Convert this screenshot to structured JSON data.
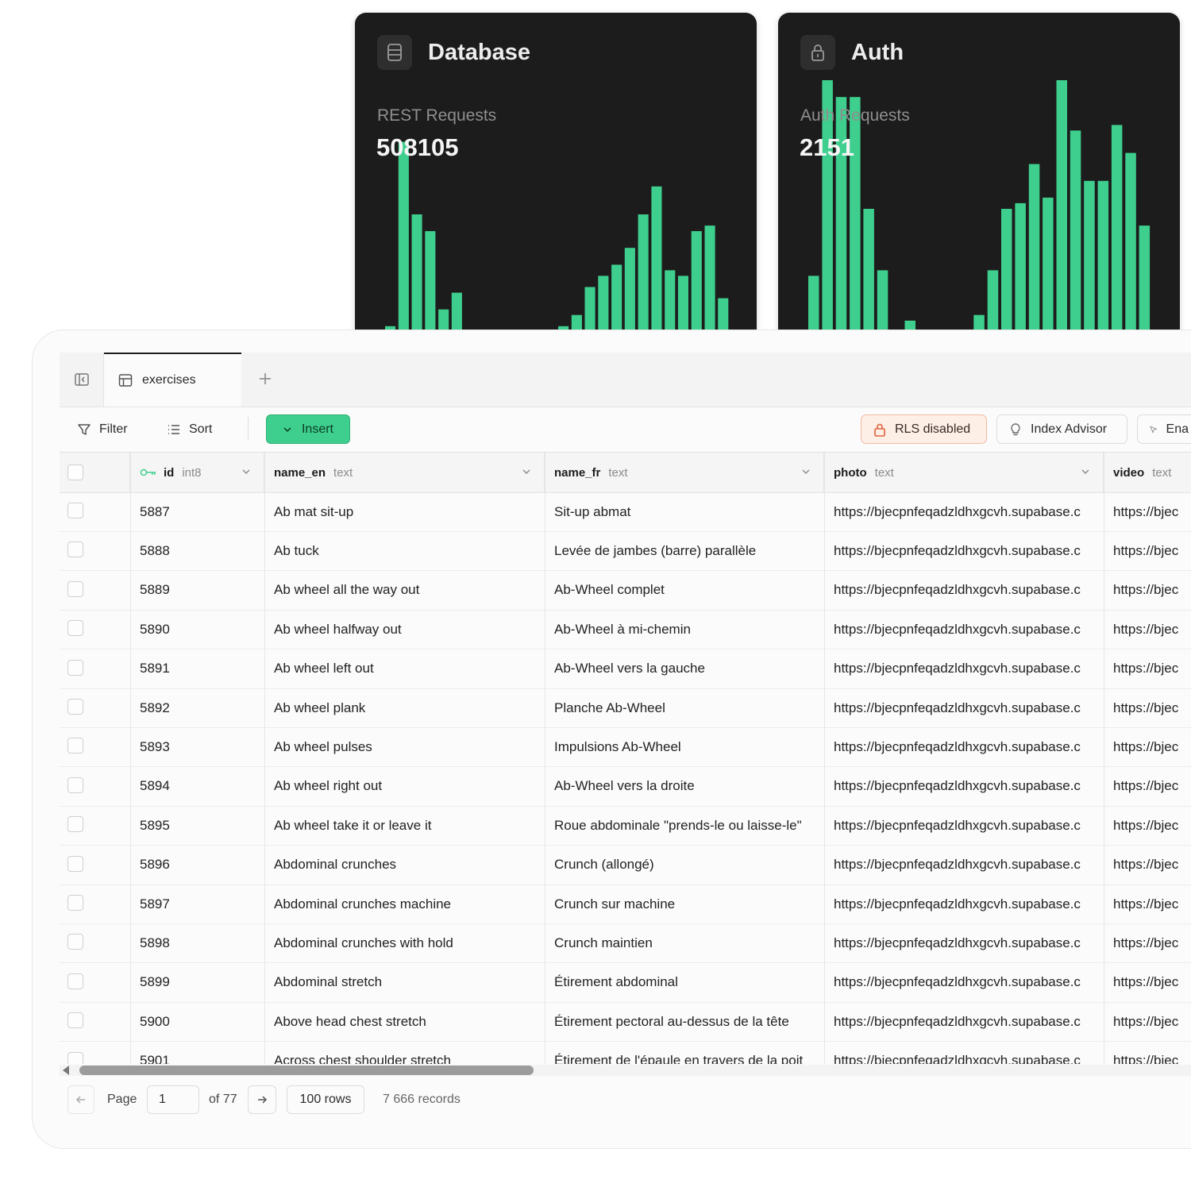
{
  "cards": {
    "database": {
      "title": "Database",
      "metric_label": "REST Requests",
      "metric_value": "508105",
      "icon": "database-icon",
      "bars": [
        5,
        38,
        25,
        22,
        8,
        11,
        4,
        1,
        0,
        0,
        0,
        0,
        1,
        5,
        7,
        12,
        14,
        16,
        19,
        25,
        30,
        15,
        14,
        22,
        23,
        10
      ],
      "accent": "#3ecf8e"
    },
    "auth": {
      "title": "Auth",
      "metric_label": "Auth Requests",
      "metric_value": "2151",
      "icon": "lock-icon",
      "bars": [
        14,
        49,
        46,
        46,
        26,
        15,
        4,
        6,
        3,
        1,
        1,
        2,
        7,
        15,
        26,
        27,
        34,
        28,
        49,
        40,
        31,
        31,
        41,
        36,
        23
      ],
      "accent": "#3ecf8e"
    }
  },
  "tabs": [
    {
      "label": "exercises",
      "icon": "table-icon"
    }
  ],
  "toolbar": {
    "filter_label": "Filter",
    "sort_label": "Sort",
    "insert_label": "Insert",
    "rls_label": "RLS disabled",
    "index_advisor_label": "Index Advisor",
    "enable_label": "Ena"
  },
  "columns": [
    {
      "name": "id",
      "type": "int8",
      "key": "key-icon"
    },
    {
      "name": "name_en",
      "type": "text"
    },
    {
      "name": "name_fr",
      "type": "text"
    },
    {
      "name": "photo",
      "type": "text"
    },
    {
      "name": "video",
      "type": "text"
    }
  ],
  "rows": [
    {
      "id": "5887",
      "name_en": "Ab mat sit-up",
      "name_fr": "Sit-up abmat",
      "photo": "https://bjecpnfeqadzldhxgcvh.supabase.c",
      "video": "https://bjec"
    },
    {
      "id": "5888",
      "name_en": "Ab tuck",
      "name_fr": "Levée de jambes (barre) parallèle",
      "photo": "https://bjecpnfeqadzldhxgcvh.supabase.c",
      "video": "https://bjec"
    },
    {
      "id": "5889",
      "name_en": "Ab wheel all the way out",
      "name_fr": "Ab-Wheel complet",
      "photo": "https://bjecpnfeqadzldhxgcvh.supabase.c",
      "video": "https://bjec"
    },
    {
      "id": "5890",
      "name_en": "Ab wheel halfway out",
      "name_fr": "Ab-Wheel à mi-chemin",
      "photo": "https://bjecpnfeqadzldhxgcvh.supabase.c",
      "video": "https://bjec"
    },
    {
      "id": "5891",
      "name_en": "Ab wheel left out",
      "name_fr": "Ab-Wheel vers la gauche",
      "photo": "https://bjecpnfeqadzldhxgcvh.supabase.c",
      "video": "https://bjec"
    },
    {
      "id": "5892",
      "name_en": "Ab wheel plank",
      "name_fr": "Planche Ab-Wheel",
      "photo": "https://bjecpnfeqadzldhxgcvh.supabase.c",
      "video": "https://bjec"
    },
    {
      "id": "5893",
      "name_en": "Ab wheel pulses",
      "name_fr": "Impulsions Ab-Wheel",
      "photo": "https://bjecpnfeqadzldhxgcvh.supabase.c",
      "video": "https://bjec"
    },
    {
      "id": "5894",
      "name_en": "Ab wheel right out",
      "name_fr": "Ab-Wheel vers la droite",
      "photo": "https://bjecpnfeqadzldhxgcvh.supabase.c",
      "video": "https://bjec"
    },
    {
      "id": "5895",
      "name_en": "Ab wheel take it or leave it",
      "name_fr": "Roue abdominale \"prends-le ou laisse-le\"",
      "photo": "https://bjecpnfeqadzldhxgcvh.supabase.c",
      "video": "https://bjec"
    },
    {
      "id": "5896",
      "name_en": "Abdominal crunches",
      "name_fr": "Crunch (allongé)",
      "photo": "https://bjecpnfeqadzldhxgcvh.supabase.c",
      "video": "https://bjec"
    },
    {
      "id": "5897",
      "name_en": "Abdominal crunches machine",
      "name_fr": "Crunch sur machine",
      "photo": "https://bjecpnfeqadzldhxgcvh.supabase.c",
      "video": "https://bjec"
    },
    {
      "id": "5898",
      "name_en": "Abdominal crunches with hold",
      "name_fr": "Crunch maintien",
      "photo": "https://bjecpnfeqadzldhxgcvh.supabase.c",
      "video": "https://bjec"
    },
    {
      "id": "5899",
      "name_en": "Abdominal stretch",
      "name_fr": "Étirement abdominal",
      "photo": "https://bjecpnfeqadzldhxgcvh.supabase.c",
      "video": "https://bjec"
    },
    {
      "id": "5900",
      "name_en": "Above head chest stretch",
      "name_fr": "Étirement pectoral au-dessus de la tête",
      "photo": "https://bjecpnfeqadzldhxgcvh.supabase.c",
      "video": "https://bjec"
    },
    {
      "id": "5901",
      "name_en": "Across chest shoulder stretch",
      "name_fr": "Étirement de l'épaule en travers de la poit",
      "photo": "https://bjecpnfeqadzldhxgcvh.supabase.c",
      "video": "https://bjec"
    }
  ],
  "pagination": {
    "page_label": "Page",
    "page_value": "1",
    "of_label": "of 77",
    "rows_label": "100 rows",
    "records_label": "7 666 records"
  }
}
